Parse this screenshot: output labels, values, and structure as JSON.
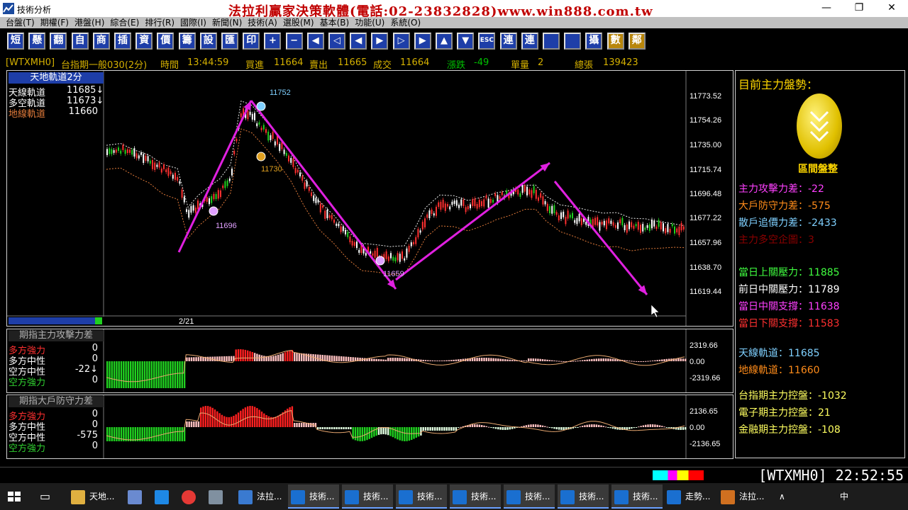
{
  "window": {
    "title": "技術分析",
    "banner": "法拉利贏家決策軟體(電話:02-23832828)www.win888.com.tw",
    "minimize": "—",
    "restore": "❐",
    "close": "✕"
  },
  "menu": [
    "台盤(T)",
    "期權(F)",
    "港盤(H)",
    "綜合(E)",
    "排行(R)",
    "國際(I)",
    "新聞(N)",
    "技術(A)",
    "選股(M)",
    "基本(B)",
    "功能(U)",
    "系統(O)"
  ],
  "toolbar": [
    "短",
    "懸",
    "翻",
    "自",
    "商",
    "插",
    "資",
    "價",
    "籌",
    "設",
    "匯",
    "印",
    "+",
    "−",
    "◀",
    "◁",
    "◀",
    "▶",
    "▷",
    "▶",
    "▲",
    "▼",
    "ESC",
    "連",
    "連",
    "",
    "",
    "攝",
    "數",
    "鄰"
  ],
  "quote": {
    "symbol": "[WTXMH0]",
    "name": "台指期一般030(2分)",
    "time_label": "時間",
    "time": "13:44:59",
    "bid_label": "買進",
    "bid": "11664",
    "ask_label": "賣出",
    "ask": "11665",
    "last_label": "成交",
    "last": "11664",
    "chg_label": "漲跌",
    "chg": "-49",
    "vol_label": "單量",
    "vol": "2",
    "total_label": "總張",
    "total": "139423"
  },
  "main": {
    "title": "天地軌道2分",
    "legend": [
      {
        "label": "天線軌道",
        "value": "11685↓",
        "color": "#ffffff"
      },
      {
        "label": "多空軌道",
        "value": "11673↓",
        "color": "#ffffff"
      },
      {
        "label": "地線軌道",
        "value": "11660",
        "color": "#e07a3a"
      }
    ],
    "yticks": [
      "11773.52",
      "11754.26",
      "11735.00",
      "11715.74",
      "11696.48",
      "11677.22",
      "11657.96",
      "11638.70",
      "11619.44"
    ],
    "xlabel": "2/21",
    "annotations": {
      "high": "11752",
      "mid": "11730",
      "low1": "11696",
      "low2": "11659"
    }
  },
  "sub1": {
    "title": "期指主力攻擊力差",
    "rows": [
      {
        "label": "多方強力",
        "value": "0",
        "color": "#ff3030"
      },
      {
        "label": "多方中性",
        "value": "0",
        "color": "#ffffff"
      },
      {
        "label": "空方中性",
        "value": "-22↓",
        "color": "#ffffff"
      },
      {
        "label": "空方強力",
        "value": "0",
        "color": "#30d030"
      }
    ],
    "yticks": [
      "2319.66",
      "0.00",
      "-2319.66"
    ]
  },
  "sub2": {
    "title": "期指大戶防守力差",
    "rows": [
      {
        "label": "多方強力",
        "value": "0",
        "color": "#ff3030"
      },
      {
        "label": "多方中性",
        "value": "0",
        "color": "#ffffff"
      },
      {
        "label": "空方中性",
        "value": "-575",
        "color": "#ffffff"
      },
      {
        "label": "空方強力",
        "value": "0",
        "color": "#30d030"
      }
    ],
    "yticks": [
      "2136.65",
      "0.00",
      "-2136.65"
    ]
  },
  "right": {
    "title": "目前主力盤勢：",
    "badge": "區間盤整",
    "items": [
      {
        "label": "主力攻擊力差：",
        "value": "-22",
        "color": "#ff40ff"
      },
      {
        "label": "大戶防守力差：",
        "value": "-575",
        "color": "#ff8c1a"
      },
      {
        "label": "散戶追價力差：",
        "value": "-2433",
        "color": "#7fd0ff"
      },
      {
        "label": "主力多空企圖：",
        "value": "3",
        "color": "#8b0000"
      },
      {
        "label": "當日上關壓力：",
        "value": "11885",
        "color": "#40ff40"
      },
      {
        "label": "前日中關壓力：",
        "value": "11789",
        "color": "#ffffff"
      },
      {
        "label": "當日中關支撐：",
        "value": "11638",
        "color": "#ff40ff"
      },
      {
        "label": "當日下關支撐：",
        "value": "11583",
        "color": "#ff3030"
      },
      {
        "label": "天線軌道：",
        "value": "11685",
        "color": "#7fd0ff"
      },
      {
        "label": "地線軌道：",
        "value": "11660",
        "color": "#ff8c1a"
      },
      {
        "label": "台指期主力控盤：",
        "value": "-1032",
        "color": "#ffff60"
      },
      {
        "label": "電子期主力控盤：",
        "value": "21",
        "color": "#ffff60"
      },
      {
        "label": "金融期主力控盤：",
        "value": "-108",
        "color": "#ffff60"
      }
    ]
  },
  "status": {
    "code": "[WTXMH0]",
    "time": "22:52:55"
  },
  "taskbar": {
    "items": [
      "天地...",
      "法拉...",
      "技術...",
      "技術...",
      "技術...",
      "技術...",
      "技術...",
      "技術...",
      "技術...",
      "走勢...",
      "法拉..."
    ],
    "ime": "中",
    "sys": "∧"
  }
}
